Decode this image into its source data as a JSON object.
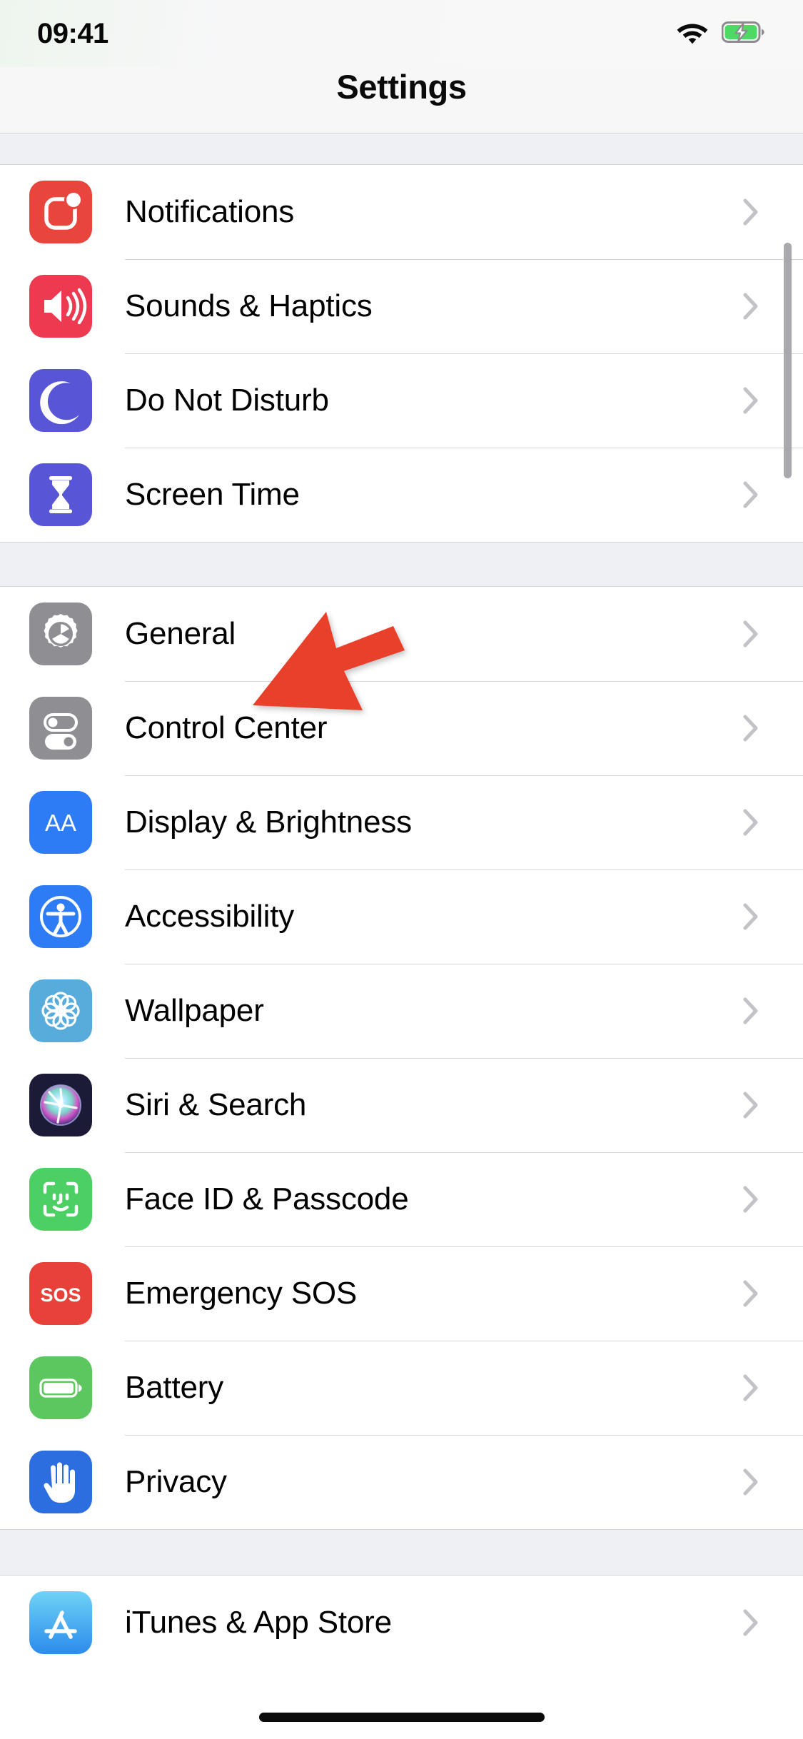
{
  "status_bar": {
    "time": "09:41",
    "wifi_icon": "wifi-icon",
    "battery_icon": "battery-charging-icon",
    "battery_charging": true,
    "battery_color": "#4CD964"
  },
  "nav": {
    "title": "Settings"
  },
  "sections": [
    {
      "id": "alerts",
      "rows": [
        {
          "label": "Notifications",
          "icon": "notifications-icon",
          "icon_color": "#E8453C",
          "chevron": "chevron-right-icon"
        },
        {
          "label": "Sounds & Haptics",
          "icon": "sounds-icon",
          "icon_color": "#EE3A51",
          "chevron": "chevron-right-icon"
        },
        {
          "label": "Do Not Disturb",
          "icon": "moon-icon",
          "icon_color": "#5856D6",
          "chevron": "chevron-right-icon"
        },
        {
          "label": "Screen Time",
          "icon": "hourglass-icon",
          "icon_color": "#5856D6",
          "chevron": "chevron-right-icon"
        }
      ]
    },
    {
      "id": "system",
      "rows": [
        {
          "label": "General",
          "icon": "gear-icon",
          "icon_color": "#8E8E93",
          "chevron": "chevron-right-icon"
        },
        {
          "label": "Control Center",
          "icon": "toggles-icon",
          "icon_color": "#8E8E93",
          "chevron": "chevron-right-icon"
        },
        {
          "label": "Display & Brightness",
          "icon": "display-aa-icon",
          "icon_color": "#2D7CF6",
          "chevron": "chevron-right-icon"
        },
        {
          "label": "Accessibility",
          "icon": "accessibility-icon",
          "icon_color": "#2D7CF6",
          "chevron": "chevron-right-icon"
        },
        {
          "label": "Wallpaper",
          "icon": "wallpaper-icon",
          "icon_color": "#57ACDC",
          "chevron": "chevron-right-icon"
        },
        {
          "label": "Siri & Search",
          "icon": "siri-icon",
          "icon_color": "#1B1B38",
          "chevron": "chevron-right-icon"
        },
        {
          "label": "Face ID & Passcode",
          "icon": "face-id-icon",
          "icon_color": "#4CD063",
          "chevron": "chevron-right-icon"
        },
        {
          "label": "Emergency SOS",
          "icon": "sos-icon",
          "icon_color": "#E8413A",
          "chevron": "chevron-right-icon",
          "icon_text": "SOS"
        },
        {
          "label": "Battery",
          "icon": "battery-icon",
          "icon_color": "#5CC75E",
          "chevron": "chevron-right-icon"
        },
        {
          "label": "Privacy",
          "icon": "privacy-hand-icon",
          "icon_color": "#2C6EE0",
          "chevron": "chevron-right-icon"
        }
      ]
    },
    {
      "id": "stores",
      "rows": [
        {
          "label": "iTunes & App Store",
          "icon": "app-store-icon",
          "icon_color": "#3FB7F3",
          "chevron": "chevron-right-icon"
        }
      ]
    }
  ],
  "annotation": {
    "arrow_color": "#E8402A",
    "points_to": "General",
    "name": "red-pointer-arrow"
  },
  "scrollbar": {
    "visible": true,
    "color": "#A8A8AD"
  },
  "home_indicator": {
    "visible": true,
    "color": "#0B0B0B"
  }
}
